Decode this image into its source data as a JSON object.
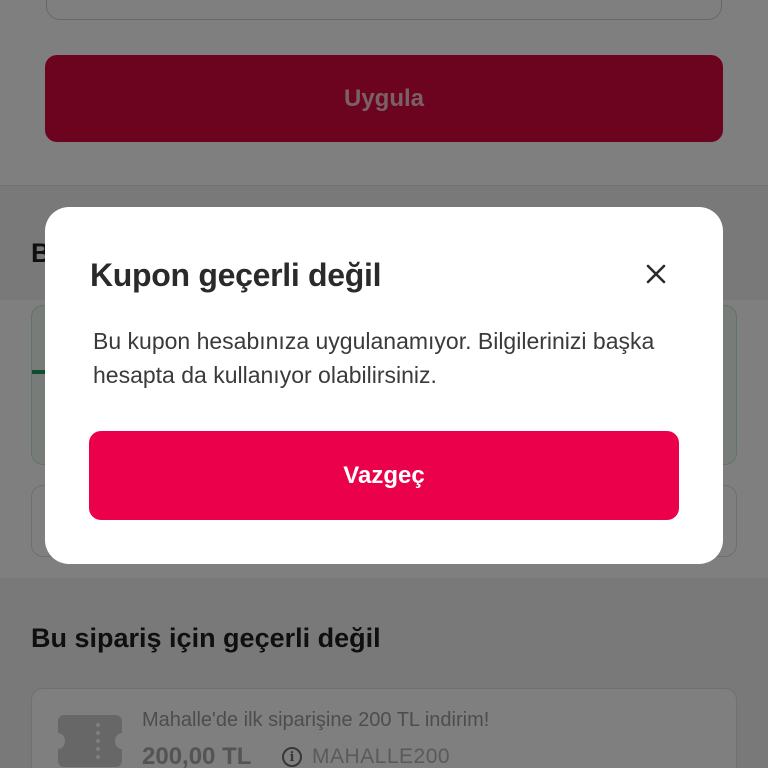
{
  "coupon_form": {
    "apply_label": "Uygula"
  },
  "sections": {
    "first_heading": "B",
    "invalid_heading": "Bu sipariş için geçerli değil"
  },
  "coupon_item": {
    "description": "Mahalle'de ilk siparişine 200 TL indirim!",
    "amount": "200,00 TL",
    "code": "MAHALLE200",
    "icon": "ticket-icon"
  },
  "modal": {
    "title": "Kupon geçerli değil",
    "message": "Bu kupon hesabınıza uygulanamıyor. Bilgilerinizi başka hesapta da kullanıyor olabilirsiniz.",
    "cancel_label": "Vazgeç",
    "close_icon": "close-icon"
  },
  "colors": {
    "primary": "#ea004b",
    "overlay": "rgba(0,0,0,0.5)"
  }
}
